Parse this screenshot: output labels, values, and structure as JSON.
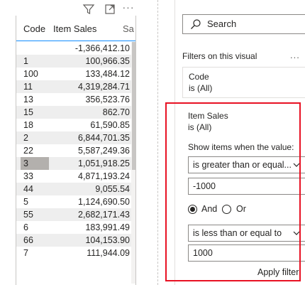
{
  "table": {
    "columns": [
      "Code",
      "Item Sales",
      "Sa"
    ],
    "rows": [
      {
        "code": "",
        "sales": "-1,366,412.10"
      },
      {
        "code": "1",
        "sales": "100,966.35"
      },
      {
        "code": "100",
        "sales": "133,484.12"
      },
      {
        "code": "11",
        "sales": "4,319,284.71"
      },
      {
        "code": "13",
        "sales": "356,523.76"
      },
      {
        "code": "15",
        "sales": "862.70"
      },
      {
        "code": "18",
        "sales": "61,590.85"
      },
      {
        "code": "2",
        "sales": "6,844,701.35"
      },
      {
        "code": "22",
        "sales": "5,587,249.36"
      },
      {
        "code": "3",
        "sales": "1,051,918.25"
      },
      {
        "code": "33",
        "sales": "4,871,193.24"
      },
      {
        "code": "44",
        "sales": "9,055.54"
      },
      {
        "code": "5",
        "sales": "1,124,690.50"
      },
      {
        "code": "55",
        "sales": "2,682,171.43"
      },
      {
        "code": "6",
        "sales": "183,991.49"
      },
      {
        "code": "66",
        "sales": "104,153.90"
      },
      {
        "code": "7",
        "sales": "111,944.09"
      }
    ],
    "selected_row": 9
  },
  "header_icons": [
    "filter-icon",
    "focus-mode-icon",
    "more-options-icon"
  ],
  "filters": {
    "search_label": "Search",
    "section_title": "Filters on this visual",
    "more": "...",
    "code_card": {
      "title": "Code",
      "subtitle": "is (All)"
    },
    "sales_card": {
      "title": "Item Sales",
      "subtitle": "is (All)",
      "show_label": "Show items when the value:",
      "condition1": "is greater than or equal...",
      "value1": "-1000",
      "and_label": "And",
      "or_label": "Or",
      "logic": "And",
      "condition2": "is less than or equal to",
      "value2": "1000",
      "apply_label": "Apply filter"
    }
  },
  "colors": {
    "highlight": "#e81123",
    "header_underline": "#118dff",
    "alt_row": "#eeeeee"
  }
}
